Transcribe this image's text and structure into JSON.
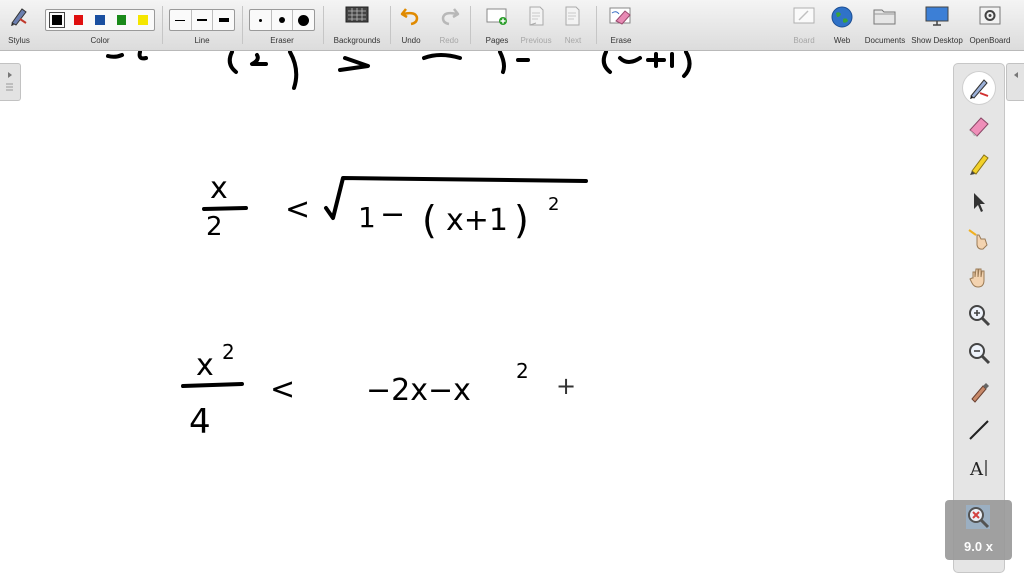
{
  "toolbar": {
    "stylus": "Stylus",
    "color": "Color",
    "line": "Line",
    "eraser": "Eraser",
    "backgrounds": "Backgrounds",
    "undo": "Undo",
    "redo": "Redo",
    "pages": "Pages",
    "previous": "Previous",
    "next": "Next",
    "erase": "Erase",
    "board": "Board",
    "web": "Web",
    "documents": "Documents",
    "show_desktop": "Show Desktop",
    "openboard": "OpenBoard"
  },
  "colors": {
    "swatches": [
      "#000000",
      "#e01010",
      "#1a4fa0",
      "#1a8a1a",
      "#f5e600"
    ],
    "selected_index": 0,
    "ink": "#000000"
  },
  "tools_right": [
    "pen-icon",
    "eraser-icon",
    "highlighter-icon",
    "pointer-icon",
    "laser-pointer-icon",
    "hand-icon",
    "zoom-in-icon",
    "zoom-out-icon",
    "capture-icon",
    "line-icon",
    "text-icon",
    "magnifier-icon"
  ],
  "text_tool_label": "A",
  "zoom": {
    "level": "9.0 x"
  },
  "board": {
    "line1_numerator": "x",
    "line1_denominator": "2",
    "line1_op": "<",
    "line1_radicand_a": "1",
    "line1_radicand_minus": "−",
    "line1_paren_open": "(",
    "line1_radicand_b": "x+1",
    "line1_paren_close": ")",
    "line1_exp": "2",
    "line2_numerator": "x",
    "line2_num_exp": "2",
    "line2_denominator": "4",
    "line2_op": "<",
    "line2_rhs": "−2x−x",
    "line2_rhs_exp": "2",
    "line2_plus": "+"
  }
}
